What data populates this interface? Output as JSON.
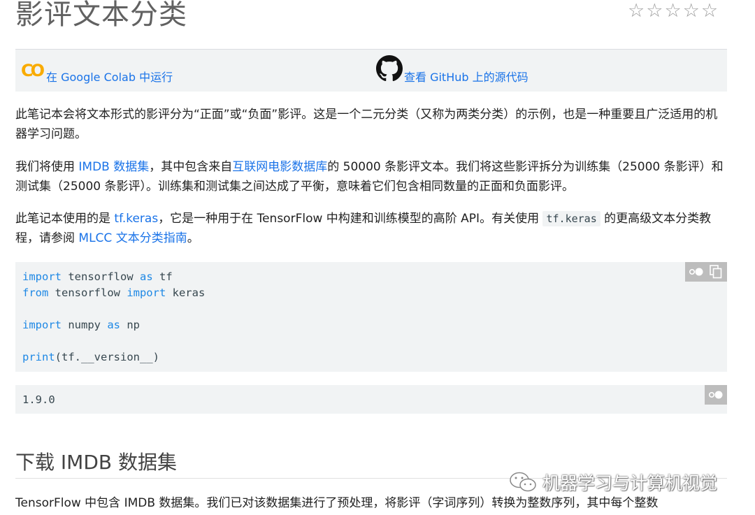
{
  "page": {
    "title": "影评文本分类",
    "rating_stars": 5,
    "rating_filled": 0
  },
  "buttons": {
    "colab_logo": "CO",
    "colab_label": "在 Google Colab 中运行",
    "github_label": "查看 GitHub 上的源代码"
  },
  "para1": {
    "text": "此笔记本会将文本形式的影评分为“正面”或“负面”影评。这是一个二元分类（又称为两类分类）的示例，也是一种重要且广泛适用的机器学习问题。"
  },
  "para2": {
    "t1": "我们将使用 ",
    "link1": "IMDB 数据集",
    "t2": "，其中包含来自",
    "link2": "互联网电影数据库",
    "t3": "的 50000 条影评文本。我们将这些影评拆分为训练集（25000 条影评）和测试集（25000 条影评）。训练集和测试集之间达成了平衡，意味着它们包含相同数量的正面和负面影评。"
  },
  "para3": {
    "t1": "此笔记本使用的是 ",
    "link1": "tf.keras",
    "t2": "，它是一种用于在 TensorFlow 中构建和训练模型的高阶 API。有关使用 ",
    "code1": "tf.keras",
    "t3": " 的更高级文本分类教程，请参阅 ",
    "link2": "MLCC 文本分类指南",
    "t4": "。"
  },
  "code": {
    "l1_kw1": "import",
    "l1_t1": " tensorflow ",
    "l1_kw2": "as",
    "l1_t2": " tf",
    "l2_kw1": "from",
    "l2_t1": " tensorflow ",
    "l2_kw2": "import",
    "l2_t2": " keras",
    "l4_kw1": "import",
    "l4_t1": " numpy ",
    "l4_kw2": "as",
    "l4_t2": " np",
    "l6_kw1": "print",
    "l6_t1": "(tf.__version__)"
  },
  "output": {
    "text": "1.9.0"
  },
  "section": {
    "heading": "下载 IMDB 数据集"
  },
  "para4": {
    "text": "TensorFlow 中包含 IMDB 数据集。我们已对该数据集进行了预处理，将影评（字词序列）转换为整数序列，其中每个整数"
  },
  "watermark": {
    "text": "机器学习与计算机视觉",
    "icon": "wechat-icon"
  },
  "colors": {
    "link": "#1a73e8",
    "keyword": "#1e88e5",
    "colab_orange": "#f9ab00",
    "code_bg": "#f1f3f4"
  }
}
